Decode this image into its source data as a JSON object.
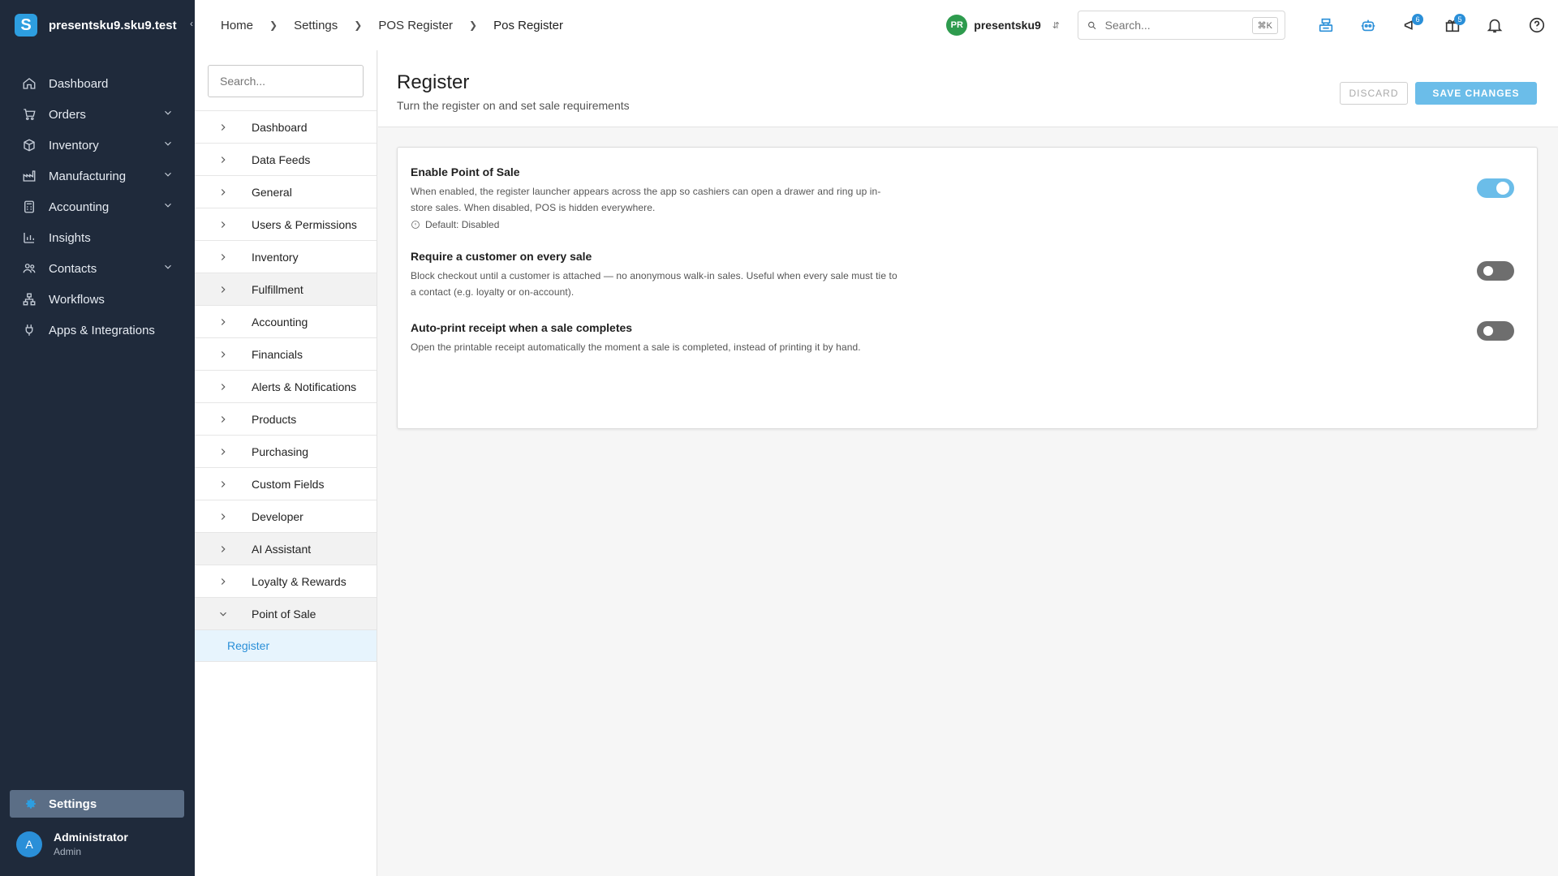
{
  "brand": {
    "name": "presentsku9.sku9.test",
    "logo_letter": "S"
  },
  "sidebar": {
    "items": [
      {
        "label": "Dashboard",
        "icon": "home-icon",
        "expandable": false
      },
      {
        "label": "Orders",
        "icon": "cart-icon",
        "expandable": true
      },
      {
        "label": "Inventory",
        "icon": "box-icon",
        "expandable": true
      },
      {
        "label": "Manufacturing",
        "icon": "factory-icon",
        "expandable": true
      },
      {
        "label": "Accounting",
        "icon": "calculator-icon",
        "expandable": true
      },
      {
        "label": "Insights",
        "icon": "bar-chart-icon",
        "expandable": false
      },
      {
        "label": "Contacts",
        "icon": "people-icon",
        "expandable": true
      },
      {
        "label": "Workflows",
        "icon": "workflow-icon",
        "expandable": false
      },
      {
        "label": "Apps & Integrations",
        "icon": "plug-icon",
        "expandable": false
      }
    ],
    "settings_label": "Settings",
    "user": {
      "initial": "A",
      "name": "Administrator",
      "role": "Admin"
    }
  },
  "breadcrumb": [
    "Home",
    "Settings",
    "POS Register",
    "Pos Register"
  ],
  "topbar": {
    "tenant_initials": "PR",
    "tenant_name": "presentsku9",
    "search_placeholder": "Search...",
    "search_shortcut": "⌘K",
    "badges": {
      "updates": "6",
      "gifts": "5"
    }
  },
  "subnav": {
    "search_placeholder": "Search...",
    "items": [
      "Dashboard",
      "Data Feeds",
      "General",
      "Users & Permissions",
      "Inventory",
      "Fulfillment",
      "Accounting",
      "Financials",
      "Alerts & Notifications",
      "Products",
      "Purchasing",
      "Custom Fields",
      "Developer",
      "AI Assistant",
      "Loyalty & Rewards",
      "Point of Sale"
    ],
    "active_child": "Register"
  },
  "page": {
    "title": "Register",
    "subtitle": "Turn the register on and set sale requirements",
    "discard_label": "DISCARD",
    "save_label": "SAVE CHANGES"
  },
  "settings": [
    {
      "title": "Enable Point of Sale",
      "description": "When enabled, the register launcher appears across the app so cashiers can open a drawer and ring up in-store sales. When disabled, POS is hidden everywhere.",
      "default": "Default: Disabled",
      "enabled": true
    },
    {
      "title": "Require a customer on every sale",
      "description": "Block checkout until a customer is attached — no anonymous walk-in sales. Useful when every sale must tie to a contact (e.g. loyalty or on-account).",
      "enabled": false
    },
    {
      "title": "Auto-print receipt when a sale completes",
      "description": "Open the printable receipt automatically the moment a sale is completed, instead of printing it by hand.",
      "enabled": false
    }
  ],
  "colors": {
    "sidebar_bg": "#1f2a3b",
    "accent": "#2a8fd8",
    "toggle_on": "#6bbde9",
    "toggle_off": "#6e6e6e"
  }
}
